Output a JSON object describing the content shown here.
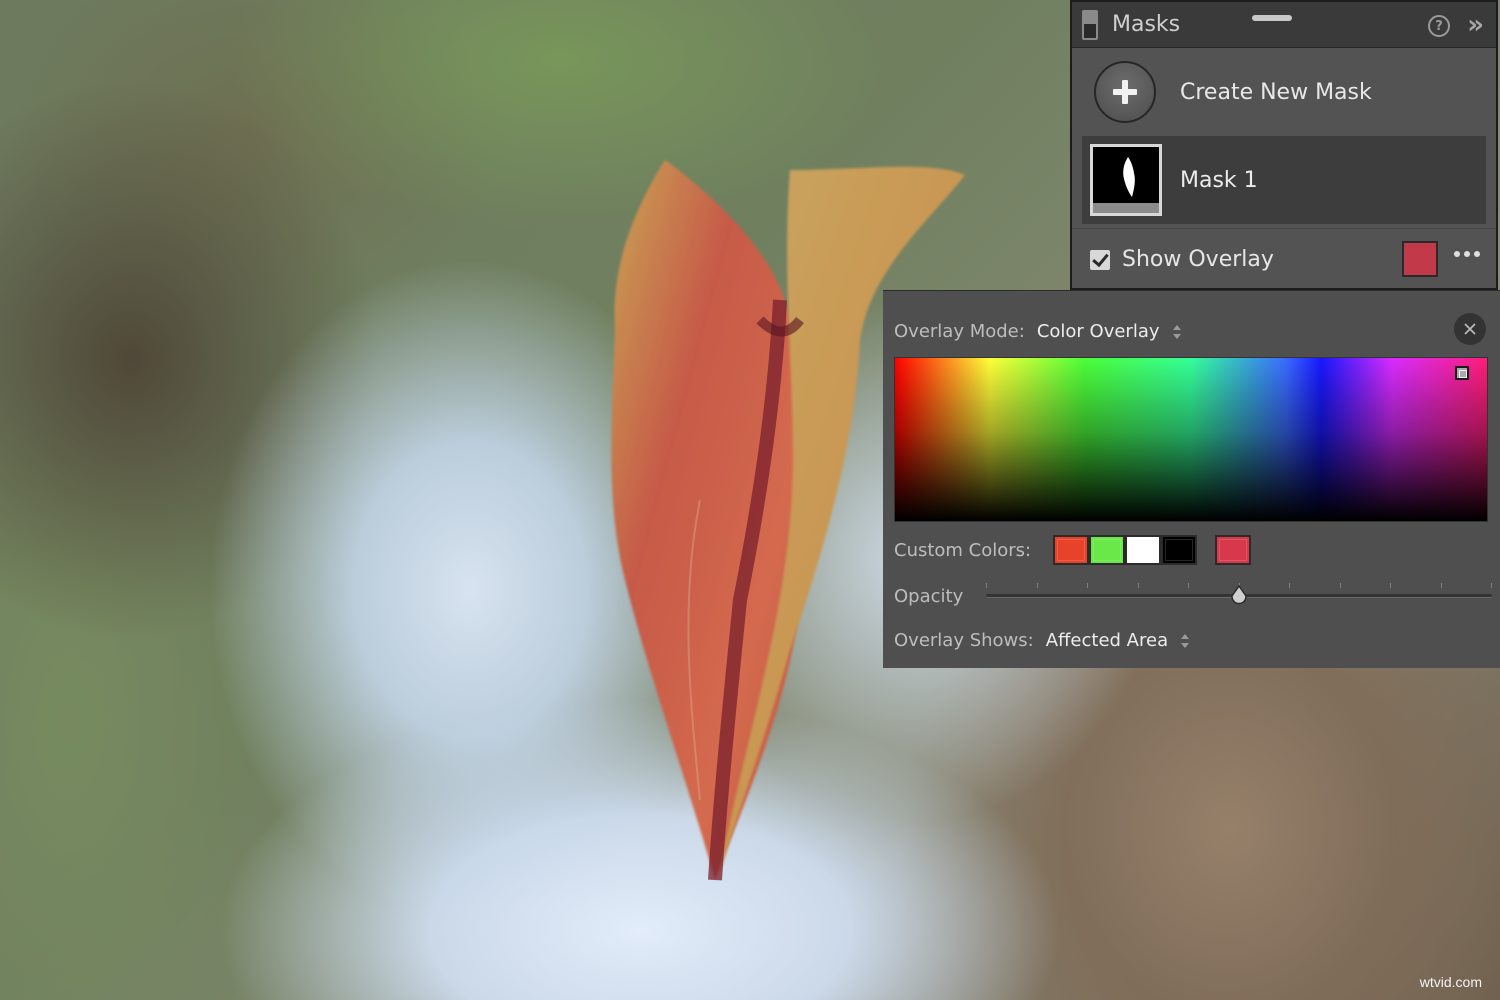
{
  "masks_panel": {
    "title": "Masks",
    "create_label": "Create New Mask",
    "mask_name": "Mask 1",
    "show_overlay_label": "Show Overlay",
    "show_overlay_checked": true,
    "overlay_color": "#c23a4a",
    "icons": [
      "panel-toggle-icon",
      "help-icon",
      "collapse-chevrons-icon",
      "plus-icon",
      "more-dots-icon"
    ]
  },
  "overlay_popup": {
    "mode_label": "Overlay Mode:",
    "mode_value": "Color Overlay",
    "custom_colors_label": "Custom Colors:",
    "custom_colors": [
      "#e8422a",
      "#6ae84a",
      "#ffffff",
      "#000000"
    ],
    "current_color": "#d8394a",
    "opacity_label": "Opacity",
    "opacity_fraction": 0.5,
    "shows_label": "Overlay Shows:",
    "shows_value": "Affected Area",
    "icons": [
      "close-icon",
      "updown-arrows-icon"
    ]
  },
  "watermark": "wtvid.com"
}
